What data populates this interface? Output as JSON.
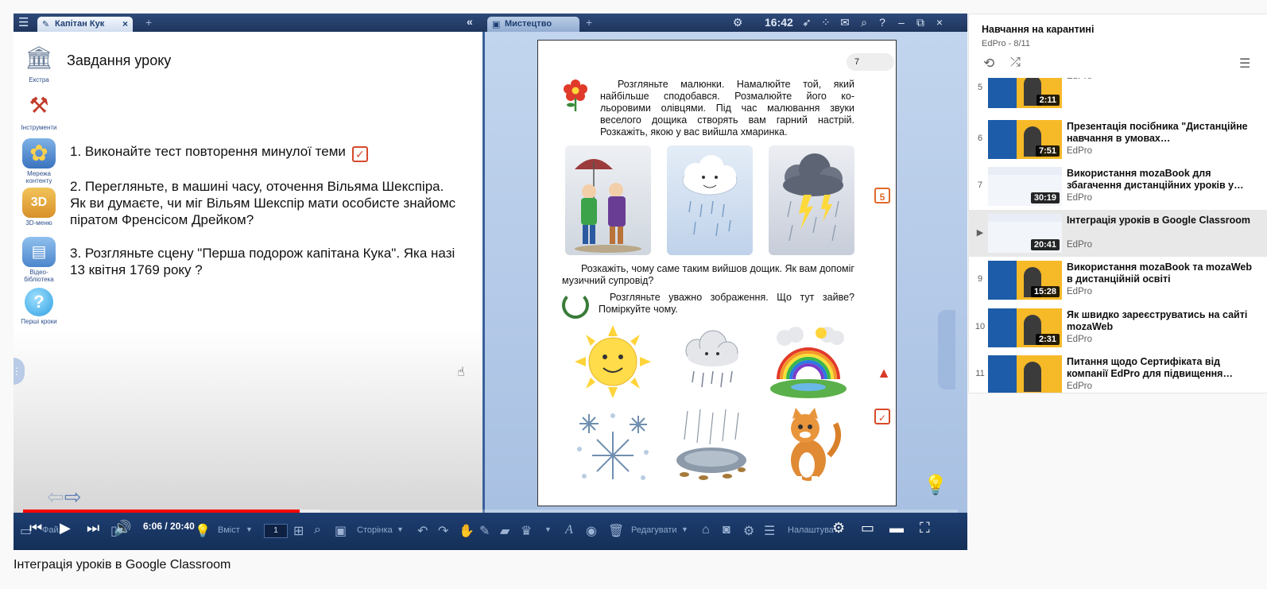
{
  "app": {
    "tabs": [
      {
        "label": "Капітан Кук"
      },
      {
        "label": "Мистецтво"
      }
    ],
    "clock": "16:42",
    "left_pane": {
      "heading": "Завдання уроку",
      "sidebar": [
        {
          "label": "Екстра",
          "icon": "museum-icon"
        },
        {
          "label": "Інструменти",
          "icon": "tools-icon"
        },
        {
          "label": "Мережа контенту",
          "icon": "network-icon"
        },
        {
          "label": "3D-меню",
          "icon": "3d-icon"
        },
        {
          "label": "Відео-бібліотека",
          "icon": "video-library-icon"
        },
        {
          "label": "Перші кроки",
          "icon": "help-icon"
        }
      ],
      "tasks": [
        {
          "line1": "1. Виконайте тест повторення минулої теми",
          "line2": ""
        },
        {
          "line1": "2. Перегляньте, в машині часу, оточення Вільяма Шекспіра.",
          "line2": "Як ви думаєте, чи міг Вільям Шекспір мати особисте знайомс",
          "line3": "піратом Френсісом Дрейком?"
        },
        {
          "line1": "3. Розгляньте сцену \"Перша подорож капітана Кука\". Яка назі",
          "line2": "13 квітня 1769 року ?"
        }
      ]
    },
    "book": {
      "page_number": "7",
      "paragraph1": "Розгляньте малюнки. Намалюйте той, який найбільше сподобався. Розмалюйте його ко-льоровими олівцями. Під час малювання звуки веселого дощика створять вам гарний настрій. Розкажіть, якою у вас вийшла хмаринка.",
      "paragraph2": "Розкажіть, чому саме таким вийшов дощик. Як вам допоміг музичний супровід?",
      "paragraph3": "Розгляньте уважно зображення. Що тут зайве? Поміркуйте чому."
    },
    "bottom_toolbar": {
      "file": "Файл",
      "content": "Вміст",
      "page_value": "1",
      "page": "Сторінка",
      "edit": "Редагувати",
      "settings": "Налаштува"
    }
  },
  "video": {
    "time_current": "6:06",
    "time_separator": " / ",
    "time_total": "20:40",
    "progress": 0.296,
    "title": "Інтеграція уроків в Google Classroom"
  },
  "playlist": {
    "title": "Навчання на карантині",
    "subtitle": "EdPro - 8/11",
    "items": [
      {
        "index": "5",
        "name": "",
        "channel": "EdPro",
        "duration": "2:11",
        "active": false,
        "thumb": "poster"
      },
      {
        "index": "6",
        "name": "Презентація посібника \"Дистанційне навчання в умовах…",
        "channel": "EdPro",
        "duration": "7:51",
        "active": false,
        "thumb": "poster"
      },
      {
        "index": "7",
        "name": "Використання mozaBook для збагачення дистанційних уроків у…",
        "channel": "EdPro",
        "duration": "30:19",
        "active": false,
        "thumb": "web"
      },
      {
        "index": "▶",
        "name": "Інтеграція уроків в Google Classroom",
        "channel": "EdPro",
        "duration": "20:41",
        "active": true,
        "thumb": "web"
      },
      {
        "index": "9",
        "name": "Використання mozaBook та mozaWeb в дистанційній освіті",
        "channel": "EdPro",
        "duration": "15:28",
        "active": false,
        "thumb": "poster"
      },
      {
        "index": "10",
        "name": "Як швидко зареєструватись на сайті mozaWeb",
        "channel": "EdPro",
        "duration": "2:31",
        "active": false,
        "thumb": "poster"
      },
      {
        "index": "11",
        "name": "Питання щодо Сертифіката від компанії EdPro для підвищення…",
        "channel": "EdPro",
        "duration": "",
        "active": false,
        "thumb": "poster"
      }
    ]
  },
  "colors": {
    "progress": "#ff0000",
    "mozabook_bar": "#1e3d70",
    "accent_red": "#d74a2a"
  }
}
